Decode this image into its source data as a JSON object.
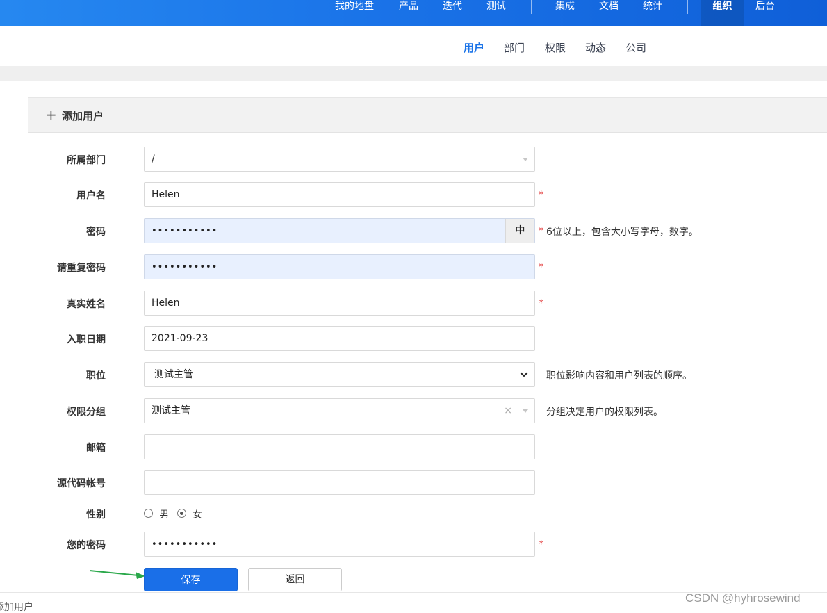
{
  "topnav": {
    "items": [
      "我的地盘",
      "产品",
      "迭代",
      "测试",
      "集成",
      "文档",
      "统计",
      "组织",
      "后台"
    ],
    "active": "组织",
    "bg": "#1a73e8"
  },
  "subnav": {
    "items": [
      "用户",
      "部门",
      "权限",
      "动态",
      "公司"
    ],
    "active": "用户"
  },
  "panel": {
    "title": "添加用户",
    "plus_icon": "plus-icon"
  },
  "form": {
    "dept": {
      "label": "所属部门",
      "value": "/"
    },
    "account": {
      "label": "用户名",
      "value": "Helen",
      "required": "*"
    },
    "password": {
      "label": "密码",
      "value": "•••••••••••",
      "addon": "中",
      "required": "*",
      "hint": "6位以上，包含大小写字母，数字。"
    },
    "password_repeat": {
      "label": "请重复密码",
      "value": "•••••••••••",
      "required": "*"
    },
    "realname": {
      "label": "真实姓名",
      "value": "Helen",
      "required": "*"
    },
    "join_date": {
      "label": "入职日期",
      "value": "2021-09-23"
    },
    "role": {
      "label": "职位",
      "value": "测试主管",
      "hint": "职位影响内容和用户列表的顺序。"
    },
    "group": {
      "label": "权限分组",
      "value": "测试主管",
      "clear": "×",
      "hint": "分组决定用户的权限列表。"
    },
    "email": {
      "label": "邮箱",
      "value": ""
    },
    "commiter": {
      "label": "源代码帐号",
      "value": ""
    },
    "gender": {
      "label": "性别",
      "options": [
        "男",
        "女"
      ],
      "selected": "女"
    },
    "verify_password": {
      "label": "您的密码",
      "value": "•••••••••••",
      "required": "*"
    }
  },
  "actions": {
    "save": "保存",
    "back": "返回"
  },
  "footer": {
    "breadcrumb": "添加用户"
  },
  "watermark": "CSDN @hyhrosewind",
  "colors": {
    "primary": "#1a6fe8",
    "required": "#e54b4b",
    "autofill": "#e8f0fe",
    "arrow": "#2aa84a"
  }
}
